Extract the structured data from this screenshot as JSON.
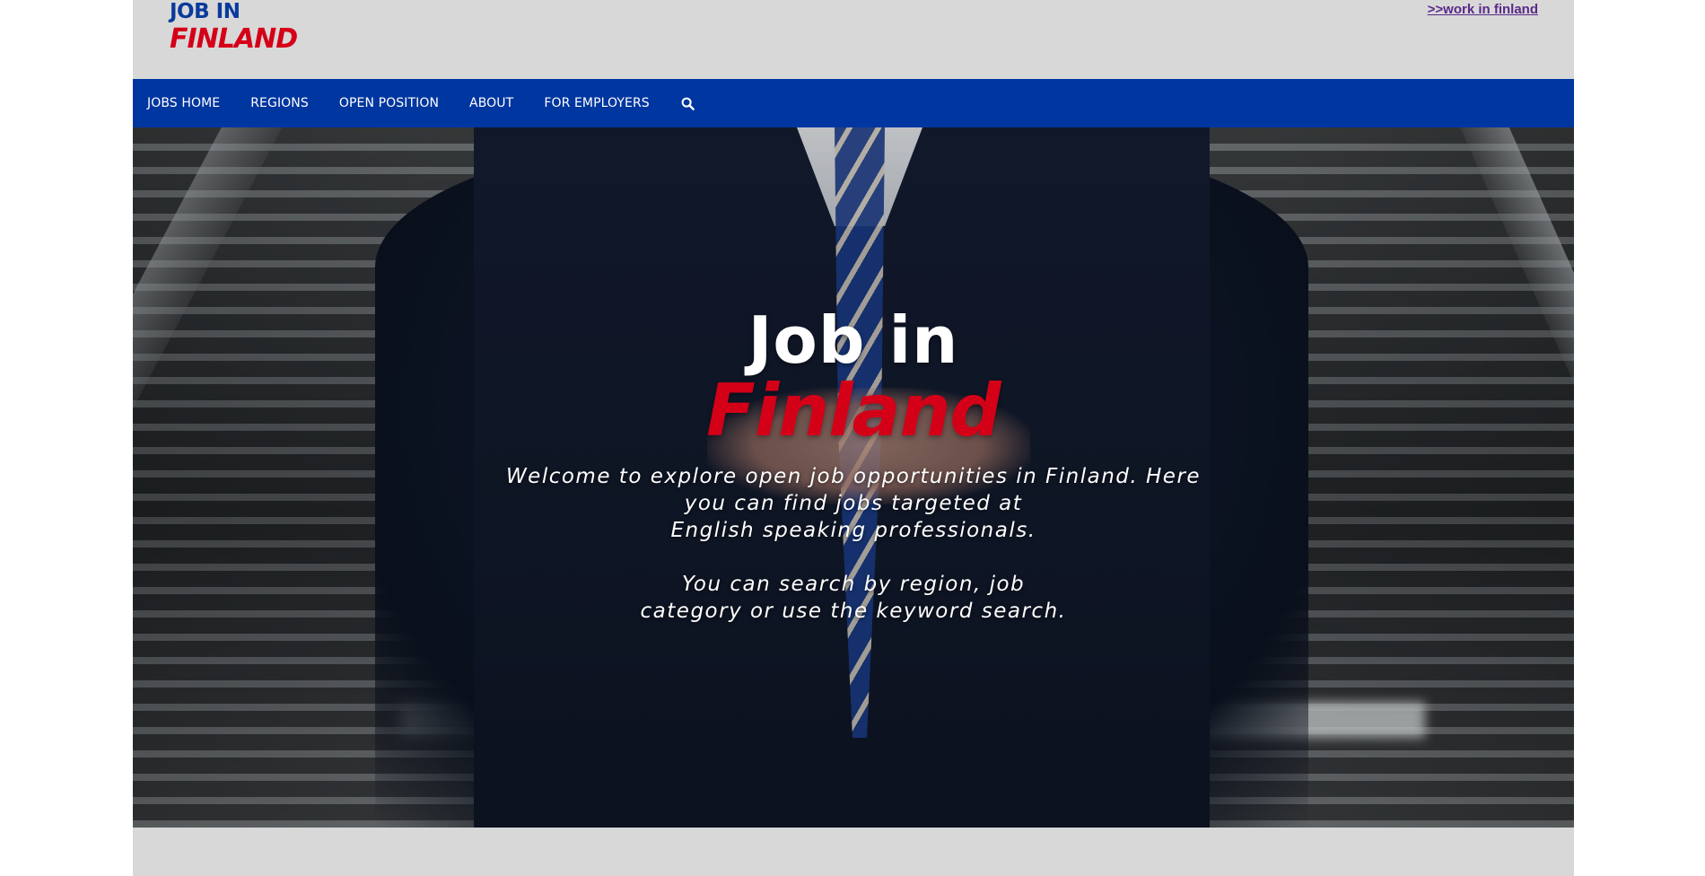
{
  "logo": {
    "line1": "JOB IN",
    "line2": "FINLAND"
  },
  "top_link": ">>work in finland",
  "nav": {
    "items": [
      {
        "label": "JOBS HOME"
      },
      {
        "label": "REGIONS"
      },
      {
        "label": "OPEN POSITION"
      },
      {
        "label": "ABOUT"
      },
      {
        "label": "FOR EMPLOYERS"
      }
    ],
    "search_icon": "search-icon"
  },
  "hero": {
    "title_line1": "Job in",
    "title_line2": "Finland",
    "desc_lines_1": [
      "Welcome to explore open job opportunities in Finland. Here",
      "you can find jobs targeted at",
      "English speaking professionals."
    ],
    "desc_lines_2": [
      "You can search by region, job",
      "category or use the keyword search."
    ]
  },
  "colors": {
    "brand_blue": "#0036a0",
    "brand_red": "#d40018",
    "background": "#d8d8d8",
    "link_purple": "#5a2a8a"
  }
}
